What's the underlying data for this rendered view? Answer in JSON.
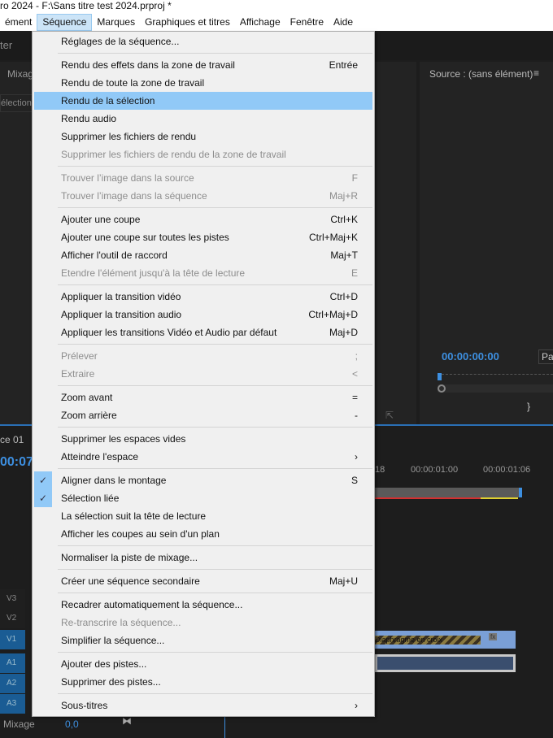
{
  "window": {
    "title": "ro 2024 - F:\\Sans titre test 2024.prproj *"
  },
  "menubar": [
    {
      "label": "ément"
    },
    {
      "label": "Séquence"
    },
    {
      "label": "Marques"
    },
    {
      "label": "Graphiques et titres"
    },
    {
      "label": "Affichage"
    },
    {
      "label": "Fenêtre"
    },
    {
      "label": "Aide"
    }
  ],
  "panels": {
    "left_tab": "ter",
    "mixer_tab": "Mixag",
    "selection": "électionn",
    "source_title": "Source : (sans élément)",
    "source_timecode": "00:00:00:00",
    "source_btn": "Pa",
    "sequence_tab": "ce 01",
    "seq_timecode": "00:07",
    "ruler": [
      "18",
      "00:00:01:00",
      "00:00:01:06"
    ],
    "clip_label": "Diaphragme en croix",
    "mixage_label": "Mixage",
    "mixage_value": "0,0"
  },
  "tracks": [
    "V3",
    "V2",
    "V1",
    "A1",
    "A2",
    "A3"
  ],
  "menu": {
    "groups": [
      [
        {
          "label": "Réglages de la séquence...",
          "shortcut": ""
        }
      ],
      [
        {
          "label": "Rendu des effets dans la zone de travail",
          "shortcut": "Entrée"
        },
        {
          "label": "Rendu de toute la zone de travail",
          "shortcut": ""
        },
        {
          "label": "Rendu de la sélection",
          "shortcut": "",
          "highlighted": true
        },
        {
          "label": "Rendu audio",
          "shortcut": ""
        },
        {
          "label": "Supprimer les fichiers de rendu",
          "shortcut": ""
        },
        {
          "label": "Supprimer les fichiers de rendu de la zone de travail",
          "shortcut": "",
          "disabled": true
        }
      ],
      [
        {
          "label": "Trouver l’image dans la source",
          "shortcut": "F",
          "disabled": true
        },
        {
          "label": "Trouver l’image dans la séquence",
          "shortcut": "Maj+R",
          "disabled": true
        }
      ],
      [
        {
          "label": "Ajouter une coupe",
          "shortcut": "Ctrl+K"
        },
        {
          "label": "Ajouter une coupe sur toutes les pistes",
          "shortcut": "Ctrl+Maj+K"
        },
        {
          "label": "Afficher l'outil de raccord",
          "shortcut": "Maj+T"
        },
        {
          "label": "Etendre l'élément jusqu'à la tête de lecture",
          "shortcut": "E",
          "disabled": true
        }
      ],
      [
        {
          "label": "Appliquer la transition vidéo",
          "shortcut": "Ctrl+D"
        },
        {
          "label": "Appliquer la transition audio",
          "shortcut": "Ctrl+Maj+D"
        },
        {
          "label": "Appliquer les transitions Vidéo et Audio par défaut",
          "shortcut": "Maj+D"
        }
      ],
      [
        {
          "label": "Prélever",
          "shortcut": ";",
          "disabled": true
        },
        {
          "label": "Extraire",
          "shortcut": "<",
          "disabled": true
        }
      ],
      [
        {
          "label": "Zoom avant",
          "shortcut": "="
        },
        {
          "label": "Zoom arrière",
          "shortcut": "-"
        }
      ],
      [
        {
          "label": "Supprimer les espaces vides",
          "shortcut": ""
        },
        {
          "label": "Atteindre l'espace",
          "shortcut": "›",
          "submenu": true
        }
      ],
      [
        {
          "label": "Aligner dans le montage",
          "shortcut": "S",
          "checked": true
        },
        {
          "label": "Sélection liée",
          "shortcut": "",
          "checked": true
        },
        {
          "label": "La sélection suit la tête de lecture",
          "shortcut": ""
        },
        {
          "label": "Afficher les coupes au sein d'un plan",
          "shortcut": ""
        }
      ],
      [
        {
          "label": "Normaliser la piste de mixage...",
          "shortcut": ""
        }
      ],
      [
        {
          "label": "Créer une séquence secondaire",
          "shortcut": "Maj+U"
        }
      ],
      [
        {
          "label": "Recadrer automatiquement la séquence...",
          "shortcut": ""
        },
        {
          "label": "Re-transcrire la séquence...",
          "shortcut": "",
          "disabled": true
        },
        {
          "label": "Simplifier la séquence...",
          "shortcut": ""
        }
      ],
      [
        {
          "label": "Ajouter des pistes...",
          "shortcut": ""
        },
        {
          "label": "Supprimer des pistes...",
          "shortcut": ""
        }
      ],
      [
        {
          "label": "Sous-titres",
          "shortcut": "›",
          "submenu": true
        }
      ]
    ]
  }
}
